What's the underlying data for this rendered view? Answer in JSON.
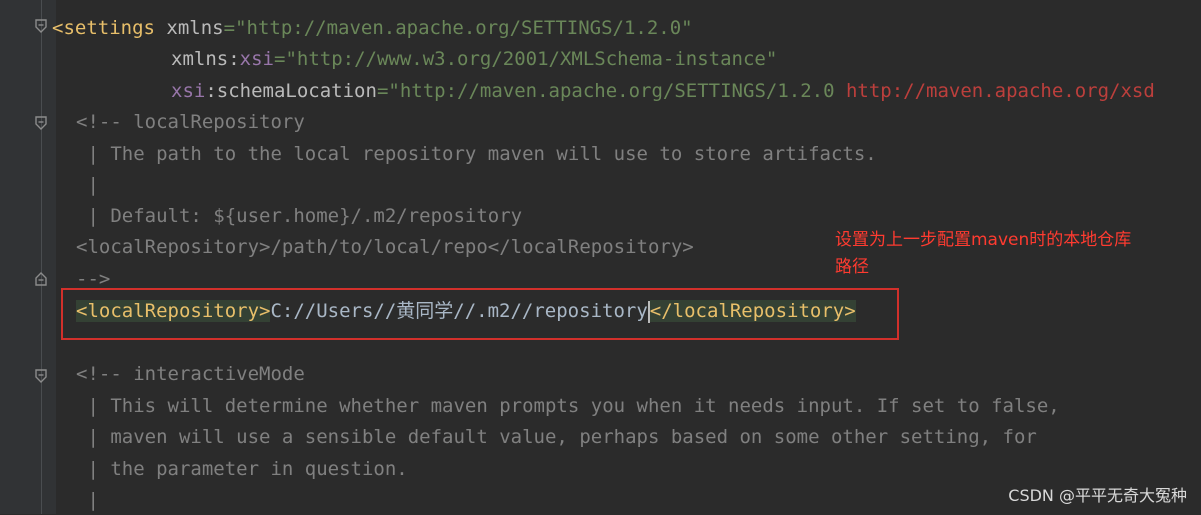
{
  "editor": {
    "line1": {
      "open": "<settings",
      "attr": "xmlns",
      "eq": "=",
      "value": "\"http://maven.apache.org/SETTINGS/1.2.0\""
    },
    "line2": {
      "ns": "xmlns",
      "colon": ":",
      "attr": "xsi",
      "eq": "=",
      "value": "\"http://www.w3.org/2001/XMLSchema-instance\""
    },
    "line3": {
      "ns": "xsi",
      "colon": ":",
      "attr": "schemaLocation",
      "eq": "=",
      "value": "\"http://maven.apache.org/SETTINGS/1.2.0 ",
      "error_value": "http://maven.apache.org/xsd"
    },
    "comment1": [
      "<!-- localRepository",
      " | The path to the local repository maven will use to store artifacts.",
      " |",
      " | Default: ${user.home}/.m2/repository",
      "<localRepository>/path/to/local/repo</localRepository>",
      "-->"
    ],
    "highlight": {
      "open_tag": "<localRepository>",
      "value": "C://Users//黄同学//.m2//repository",
      "close_tag": "</localRepository>"
    },
    "comment2": [
      "<!-- interactiveMode",
      " | This will determine whether maven prompts you when it needs input. If set to false,",
      " | maven will use a sensible default value, perhaps based on some other setting, for",
      " | the parameter in question.",
      " |"
    ]
  },
  "annotation": {
    "line1": "设置为上一步配置maven时的本地仓库",
    "line2": "路径"
  },
  "watermark": "CSDN @平平无奇大冤种",
  "colors": {
    "background": "#2b2b2b",
    "tag": "#e8bf6a",
    "string": "#6a8759",
    "comment": "#808080",
    "error": "#bc3f3c",
    "annotation": "#ff3b30"
  }
}
